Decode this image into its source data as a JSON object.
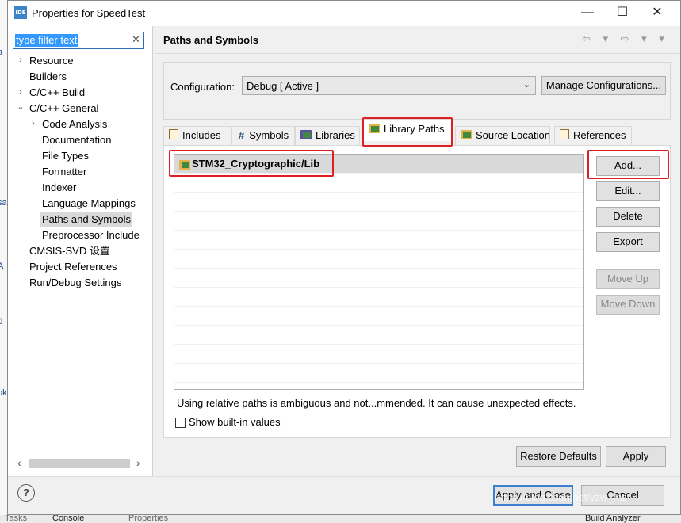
{
  "window": {
    "title": "Properties for SpeedTest",
    "icon_label": "IDE",
    "minimize": "—",
    "maximize": "☐",
    "close": "✕"
  },
  "filter": {
    "value": "type filter text",
    "clear": "✕"
  },
  "tree": [
    {
      "label": "Resource",
      "twisty": "›"
    },
    {
      "label": "Builders",
      "twisty": ""
    },
    {
      "label": "C/C++ Build",
      "twisty": "›"
    },
    {
      "label": "C/C++ General",
      "twisty": "⌄"
    },
    {
      "label": "Code Analysis",
      "twisty": "›"
    },
    {
      "label": "Documentation",
      "twisty": ""
    },
    {
      "label": "File Types",
      "twisty": ""
    },
    {
      "label": "Formatter",
      "twisty": ""
    },
    {
      "label": "Indexer",
      "twisty": ""
    },
    {
      "label": "Language Mappings",
      "twisty": ""
    },
    {
      "label": "Paths and Symbols",
      "twisty": ""
    },
    {
      "label": "Preprocessor Include",
      "twisty": ""
    },
    {
      "label": "CMSIS-SVD 设置",
      "twisty": ""
    },
    {
      "label": "Project References",
      "twisty": ""
    },
    {
      "label": "Run/Debug Settings",
      "twisty": ""
    }
  ],
  "scroll": {
    "left": "‹",
    "right": "›"
  },
  "page": {
    "title": "Paths and Symbols",
    "nav_icons": "⇦ ▾ ⇨ ▾ ▾"
  },
  "configuration": {
    "label": "Configuration:",
    "selected": "Debug  [ Active ]",
    "arrow": "⌄",
    "manage_button": "Manage Configurations..."
  },
  "tabs": [
    {
      "label": "Includes",
      "glyph": ""
    },
    {
      "label": "Symbols",
      "glyph": "#"
    },
    {
      "label": "Libraries",
      "glyph": ""
    },
    {
      "label": "Library Paths",
      "glyph": "",
      "active": true
    },
    {
      "label": "Source Location",
      "glyph": ""
    },
    {
      "label": "References",
      "glyph": ""
    }
  ],
  "library_paths": [
    "STM32_Cryptographic/Lib"
  ],
  "buttons": {
    "add": "Add...",
    "edit": "Edit...",
    "delete": "Delete",
    "export": "Export",
    "move_up": "Move Up",
    "move_down": "Move Down",
    "restore_defaults": "Restore Defaults",
    "apply": "Apply",
    "apply_and_close": "Apply and Close",
    "cancel": "Cancel",
    "help": "?"
  },
  "warning": "Using relative paths is ambiguous and not...mmended. It can cause unexpected effects.",
  "show_builtin": {
    "label": "Show built-in values",
    "checked": false
  },
  "workbench_tabs": [
    "Tasks",
    "Console",
    "Properties",
    "Build Analyzer"
  ],
  "watermark": "https://blog.csdn.net/yzw_mz",
  "colors": {
    "annotation": "#e02020",
    "selection": "#d9d9d9",
    "accent": "#3c7fd0"
  }
}
